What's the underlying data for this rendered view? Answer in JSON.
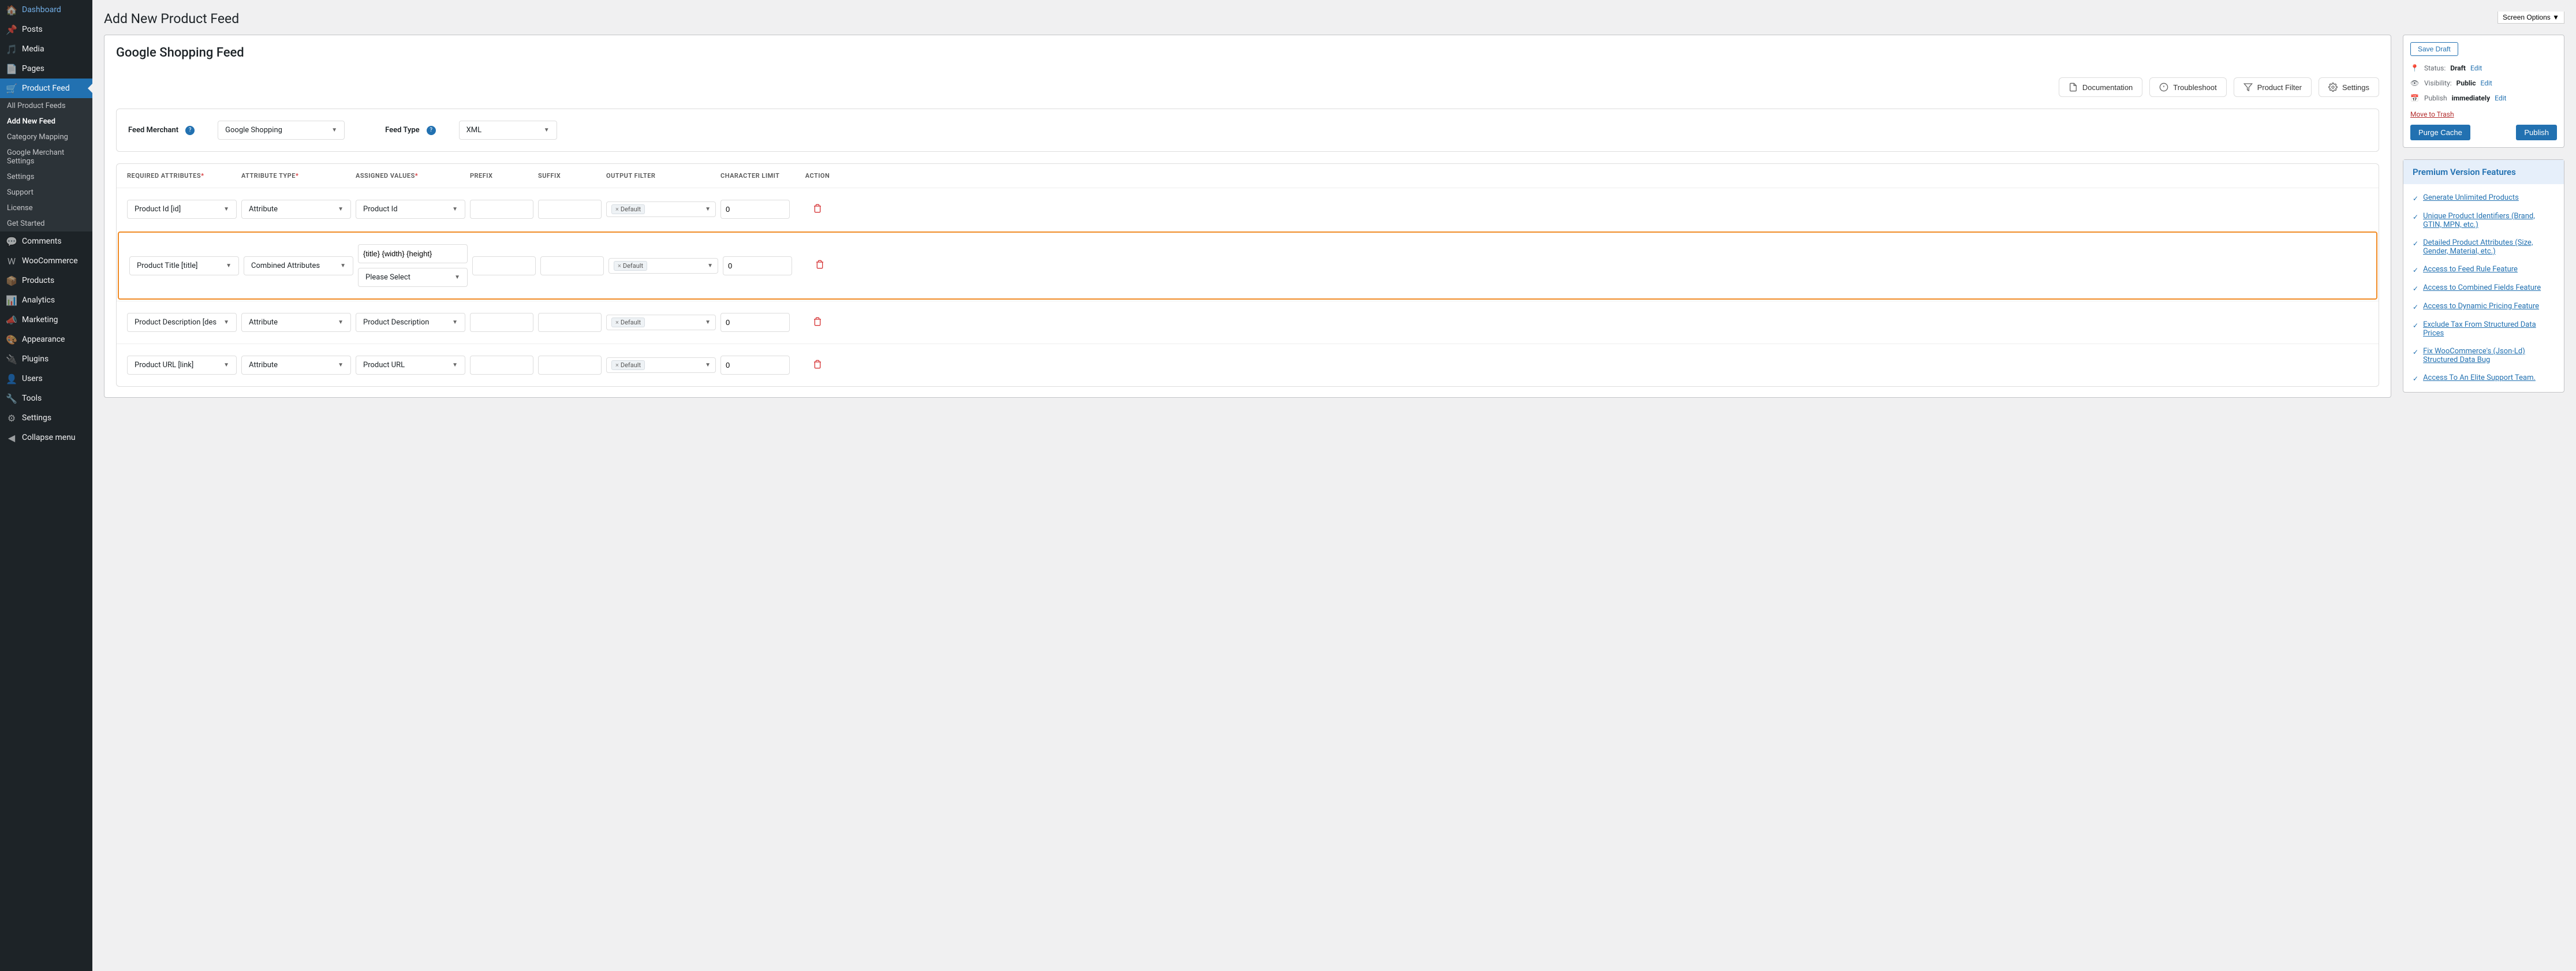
{
  "screen_options": "Screen Options",
  "page_title": "Add New Product Feed",
  "feed_title": "Google Shopping Feed",
  "sidebar": [
    {
      "name": "dashboard",
      "icon": "dashboard",
      "label": "Dashboard"
    },
    {
      "name": "posts",
      "icon": "pin",
      "label": "Posts"
    },
    {
      "name": "media",
      "icon": "media",
      "label": "Media"
    },
    {
      "name": "pages",
      "icon": "page",
      "label": "Pages"
    },
    {
      "name": "product-feed",
      "icon": "cart",
      "label": "Product Feed",
      "active": true,
      "submenu": [
        {
          "label": "All Product Feeds"
        },
        {
          "label": "Add New Feed",
          "active": true
        },
        {
          "label": "Category Mapping"
        },
        {
          "label": "Google Merchant Settings"
        },
        {
          "label": "Settings"
        },
        {
          "label": "Support"
        },
        {
          "label": "License"
        },
        {
          "label": "Get Started"
        }
      ]
    },
    {
      "name": "comments",
      "icon": "comment",
      "label": "Comments"
    },
    {
      "name": "woocommerce",
      "icon": "woo",
      "label": "WooCommerce"
    },
    {
      "name": "products",
      "icon": "product",
      "label": "Products"
    },
    {
      "name": "analytics",
      "icon": "analytics",
      "label": "Analytics"
    },
    {
      "name": "marketing",
      "icon": "marketing",
      "label": "Marketing"
    },
    {
      "name": "appearance",
      "icon": "brush",
      "label": "Appearance"
    },
    {
      "name": "plugins",
      "icon": "plugin",
      "label": "Plugins"
    },
    {
      "name": "users",
      "icon": "user",
      "label": "Users"
    },
    {
      "name": "tools",
      "icon": "tool",
      "label": "Tools"
    },
    {
      "name": "settings",
      "icon": "settings",
      "label": "Settings"
    },
    {
      "name": "collapse",
      "icon": "collapse",
      "label": "Collapse menu"
    }
  ],
  "action_buttons": {
    "documentation": "Documentation",
    "troubleshoot": "Troubleshoot",
    "product_filter": "Product Filter",
    "settings": "Settings"
  },
  "merchant_row": {
    "feed_merchant_label": "Feed Merchant",
    "feed_merchant_value": "Google Shopping",
    "feed_type_label": "Feed Type",
    "feed_type_value": "XML"
  },
  "table": {
    "headers": {
      "required_attributes": "Required Attributes",
      "attribute_type": "Attribute Type",
      "assigned_values": "Assigned Values",
      "prefix": "Prefix",
      "suffix": "Suffix",
      "output_filter": "Output Filter",
      "character_limit": "Character Limit",
      "action": "Action"
    },
    "default_tag": "Default",
    "please_select": "Please Select",
    "rows": [
      {
        "attr": "Product Id [id]",
        "type": "Attribute",
        "assigned": "Product Id",
        "char": "0"
      },
      {
        "attr": "Product Title [title]",
        "type": "Combined Attributes",
        "assigned": "{title} {width} {height}",
        "char": "0",
        "highlight": true,
        "combined": true
      },
      {
        "attr": "Product Description [des",
        "type": "Attribute",
        "assigned": "Product Description",
        "char": "0"
      },
      {
        "attr": "Product URL [link]",
        "type": "Attribute",
        "assigned": "Product URL",
        "char": "0"
      }
    ]
  },
  "publish": {
    "save_draft": "Save Draft",
    "status_label": "Status:",
    "status_value": "Draft",
    "status_edit": "Edit",
    "visibility_label": "Visibility:",
    "visibility_value": "Public",
    "visibility_edit": "Edit",
    "publish_label": "Publish",
    "publish_value": "immediately",
    "publish_edit": "Edit",
    "trash": "Move to Trash",
    "purge": "Purge Cache",
    "publish_btn": "Publish"
  },
  "premium": {
    "title": "Premium Version Features",
    "items": [
      "Generate Unlimited Products",
      "Unique Product Identifiers (Brand, GTIN, MPN, etc.)",
      "Detailed Product Attributes (Size, Gender, Material, etc.)",
      "Access to Feed Rule Feature",
      "Access to Combined Fields Feature",
      "Access to Dynamic Pricing Feature",
      "Exclude Tax From Structured Data Prices",
      "Fix WooCommerce's (Json-Ld) Structured Data Bug",
      "Access To An Elite Support Team."
    ]
  }
}
